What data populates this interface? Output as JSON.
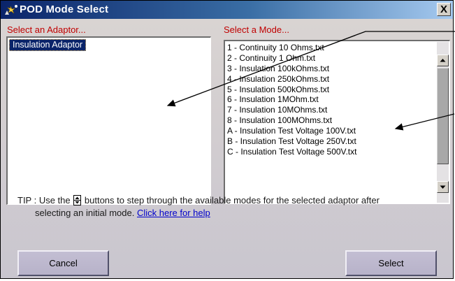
{
  "window": {
    "title": "POD Mode Select",
    "close_label": "X"
  },
  "adaptor_panel": {
    "label": "Select an Adaptor...",
    "items": [
      "Insulation Adaptor"
    ],
    "selected": "Insulation Adaptor"
  },
  "mode_panel": {
    "label": "Select a Mode...",
    "items": [
      "1 - Continuity 10 Ohms.txt",
      "2 - Continuity 1 Ohm.txt",
      "3 - Insulation 100kOhms.txt",
      "4 - Insulation 250kOhms.txt",
      "5 - Insulation 500kOhms.txt",
      "6 - Insulation 1MOhm.txt",
      "7 - Insulation 10MOhms.txt",
      "8 - Insulation 100MOhms.txt",
      "A - Insulation Test Voltage 100V.txt",
      "B - Insulation Test Voltage 250V.txt",
      "C - Insulation Test Voltage 500V.txt"
    ]
  },
  "tip": {
    "prefix": "TIP : Use the",
    "middle": "buttons to step through the available modes for the selected adaptor after",
    "line2": "selecting an initial mode.",
    "link": "Click here for help"
  },
  "buttons": {
    "cancel": "Cancel",
    "select": "Select"
  },
  "icons": {
    "title": "app-icon",
    "updown": "up-down-arrows-icon",
    "scroll_up": "scroll-up-arrow-icon",
    "scroll_down": "scroll-down-arrow-icon"
  },
  "colors": {
    "title_bar_start": "#0a246a",
    "title_bar_end": "#a6caf0",
    "group_label": "#c00000",
    "selection": "#0a246a",
    "link": "#0000cc"
  }
}
